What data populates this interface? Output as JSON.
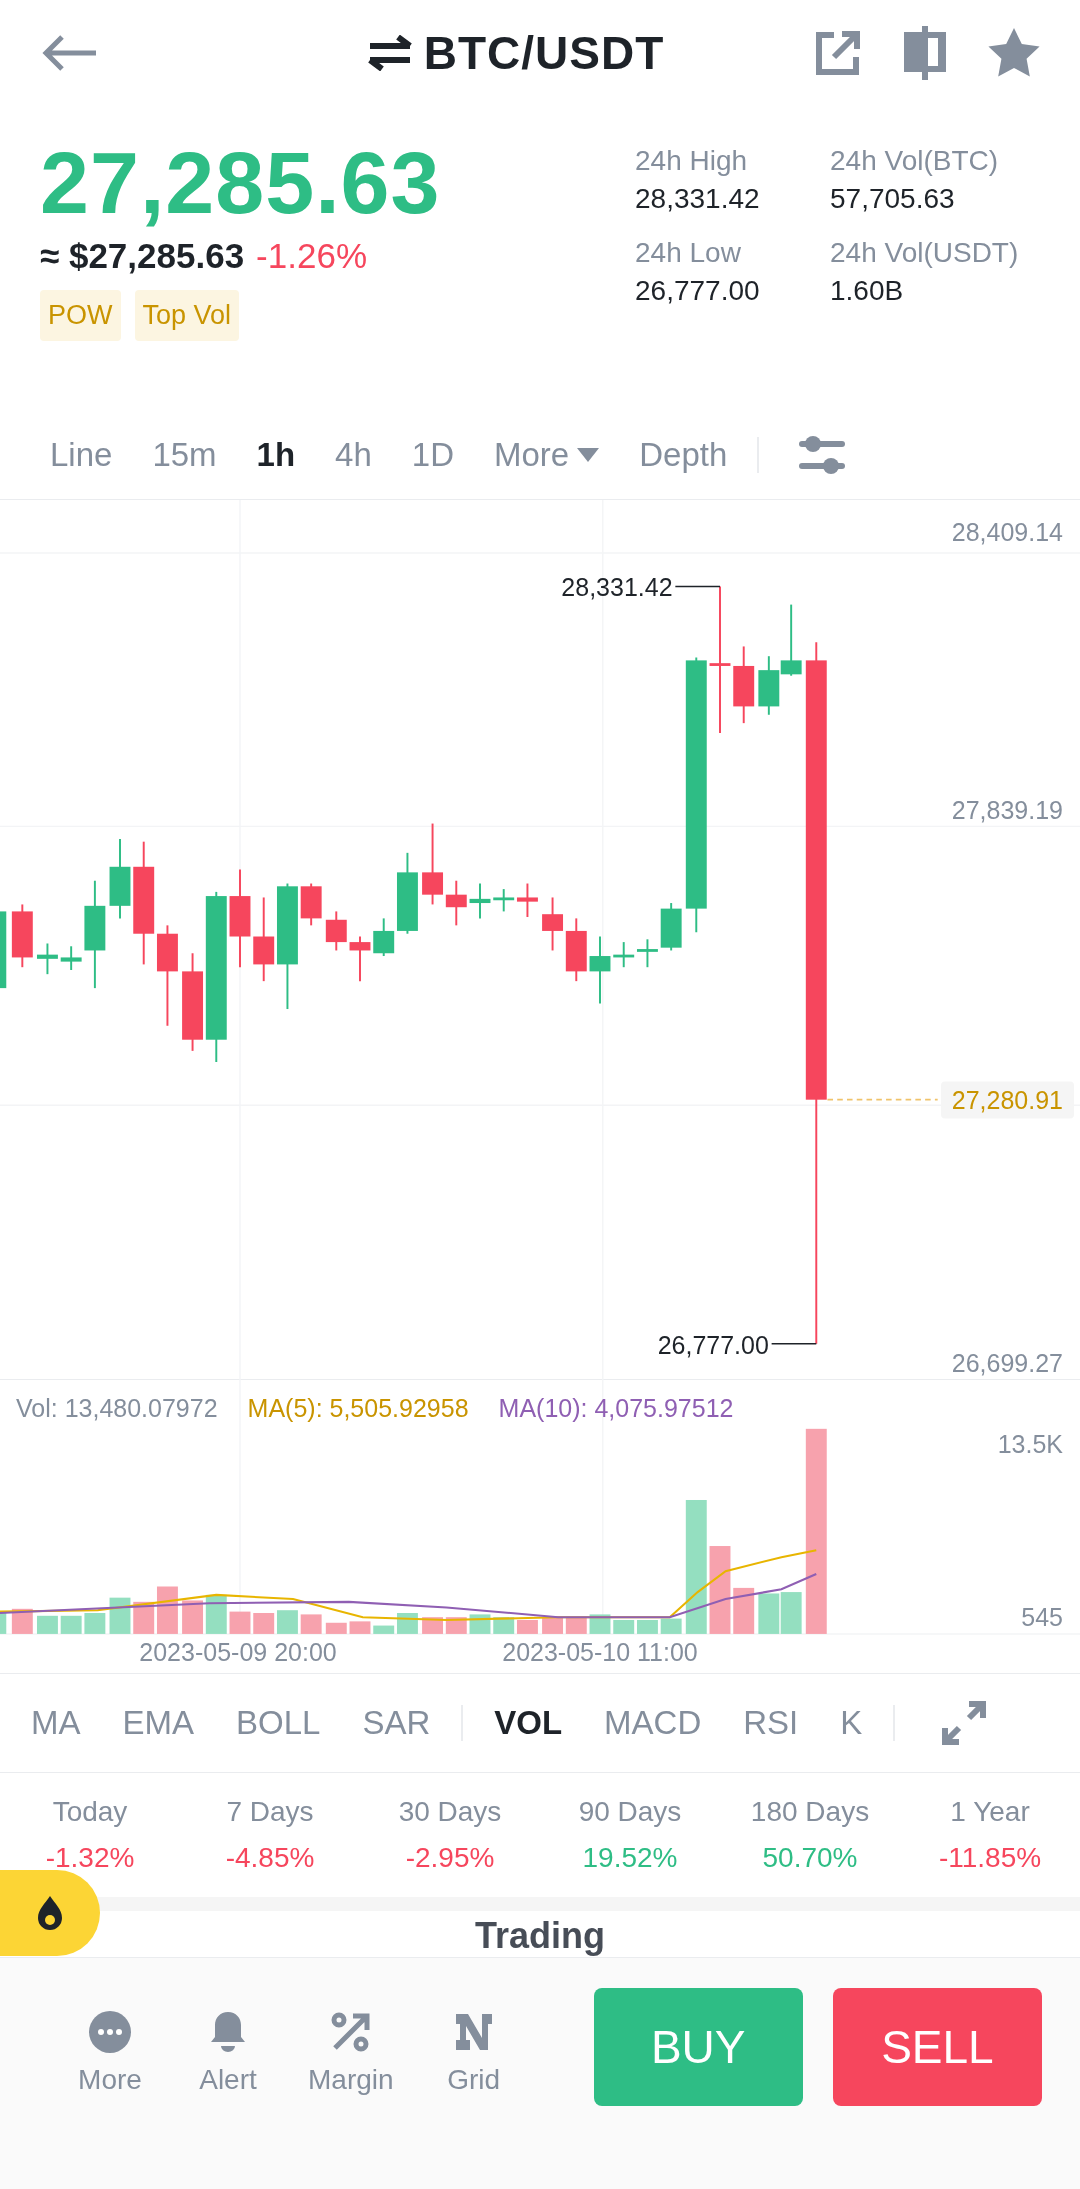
{
  "header": {
    "title": "BTC/USDT"
  },
  "price": {
    "last": "27,285.63",
    "fiat": "≈ $27,285.63",
    "change": "-1.26%"
  },
  "tags": [
    "POW",
    "Top Vol"
  ],
  "stats": [
    {
      "label": "24h High",
      "value": "28,331.42"
    },
    {
      "label": "24h Vol(BTC)",
      "value": "57,705.63"
    },
    {
      "label": "24h Low",
      "value": "26,777.00"
    },
    {
      "label": "24h Vol(USDT)",
      "value": "1.60B"
    }
  ],
  "intervals": [
    {
      "label": "Line",
      "selected": false,
      "kind": "tab"
    },
    {
      "label": "15m",
      "selected": false,
      "kind": "tab"
    },
    {
      "label": "1h",
      "selected": true,
      "kind": "tab"
    },
    {
      "label": "4h",
      "selected": false,
      "kind": "tab"
    },
    {
      "label": "1D",
      "selected": false,
      "kind": "tab"
    },
    {
      "label": "More",
      "selected": false,
      "kind": "dropdown"
    },
    {
      "label": "Depth",
      "selected": false,
      "kind": "tab"
    }
  ],
  "chart": {
    "y_axis": [
      "28,409.14",
      "27,839.19",
      "26,699.27"
    ],
    "last_price": "27,280.91",
    "high_label": "28,331.42",
    "low_label": "26,777.00"
  },
  "volume": {
    "vol": "Vol: 13,480.07972",
    "ma5": "MA(5): 5,505.92958",
    "ma10": "MA(10): 4,075.97512",
    "y_axis": [
      "13.5K",
      "545"
    ],
    "x_axis": [
      "2023-05-09 20:00",
      "2023-05-10 11:00"
    ]
  },
  "indicators": [
    {
      "label": "MA",
      "selected": false
    },
    {
      "label": "EMA",
      "selected": false
    },
    {
      "label": "BOLL",
      "selected": false
    },
    {
      "label": "SAR",
      "selected": false
    },
    {
      "label": "VOL",
      "selected": true
    },
    {
      "label": "MACD",
      "selected": false
    },
    {
      "label": "RSI",
      "selected": false
    },
    {
      "label": "K",
      "selected": false
    }
  ],
  "performance": [
    {
      "label": "Today",
      "value": "-1.32%",
      "color": "#f6465d"
    },
    {
      "label": "7 Days",
      "value": "-4.85%",
      "color": "#f6465d"
    },
    {
      "label": "30 Days",
      "value": "-2.95%",
      "color": "#f6465d"
    },
    {
      "label": "90 Days",
      "value": "19.52%",
      "color": "#2ebd85"
    },
    {
      "label": "180 Days",
      "value": "50.70%",
      "color": "#2ebd85"
    },
    {
      "label": "1 Year",
      "value": "-11.85%",
      "color": "#f6465d"
    }
  ],
  "section_title": "Trading",
  "actions": [
    {
      "label": "More",
      "kind": "more"
    },
    {
      "label": "Alert",
      "kind": "alert"
    },
    {
      "label": "Margin",
      "kind": "margin"
    },
    {
      "label": "Grid",
      "kind": "grid"
    }
  ],
  "buy": "BUY",
  "sell": "SELL"
}
